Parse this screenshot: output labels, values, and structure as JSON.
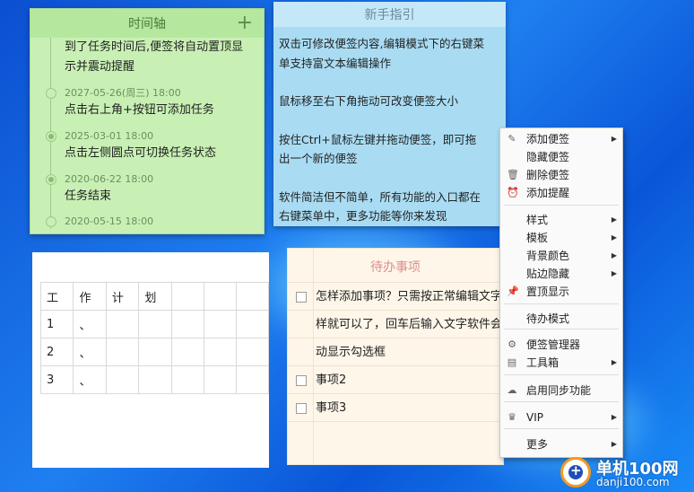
{
  "timeline": {
    "title": "时间轴",
    "add_icon": "plus-icon",
    "top_text": [
      "到了任务时间后,便签将自动置顶显",
      "示并震动提醒"
    ],
    "items": [
      {
        "date": "2027-05-26(周三) 18:00",
        "text": "点击右上角+按钮可添加任务",
        "done": false
      },
      {
        "date": "2025-03-01 18:00",
        "text": "点击左侧圆点可切换任务状态",
        "done": true
      },
      {
        "date": "2020-06-22 18:00",
        "text": "任务结束",
        "done": true
      }
    ],
    "partial_date": "2020-05-15 18:00"
  },
  "guide": {
    "title": "新手指引",
    "paragraphs": [
      [
        "双击可修改便签内容,编辑模式下的右键菜",
        "单支持富文本编辑操作"
      ],
      [
        "鼠标移至右下角拖动可改变便签大小"
      ],
      [
        "按住Ctrl+鼠标左键并拖动便签，即可拖",
        "出一个新的便签"
      ],
      [
        "软件简洁但不简单，所有功能的入口都在",
        "右键菜单中，更多功能等你来发现"
      ]
    ]
  },
  "table_note": {
    "rows": [
      [
        "工",
        "作",
        "计",
        "划",
        "",
        "",
        ""
      ],
      [
        "1",
        "、",
        "",
        "",
        "",
        "",
        ""
      ],
      [
        "2",
        "、",
        "",
        "",
        "",
        "",
        ""
      ],
      [
        "3",
        "、",
        "",
        "",
        "",
        "",
        ""
      ]
    ]
  },
  "todo": {
    "title": "待办事项",
    "rows": [
      {
        "text": "怎样添加事项？只需按正常编辑文字",
        "checkbox": true
      },
      {
        "text": "样就可以了，回车后输入文字软件会",
        "checkbox": false
      },
      {
        "text": "动显示勾选框",
        "checkbox": false
      },
      {
        "text": "事项2",
        "checkbox": true
      },
      {
        "text": "事项3",
        "checkbox": true
      }
    ]
  },
  "menu": {
    "items": [
      {
        "label": "添加便签",
        "icon": "add-note-icon",
        "submenu": true
      },
      {
        "label": "隐藏便签",
        "icon": "",
        "submenu": false
      },
      {
        "label": "删除便签",
        "icon": "trash-icon",
        "submenu": false
      },
      {
        "label": "添加提醒",
        "icon": "alarm-clock-icon",
        "submenu": false
      },
      {
        "label": "样式",
        "icon": "",
        "submenu": true
      },
      {
        "label": "模板",
        "icon": "",
        "submenu": true
      },
      {
        "label": "背景颜色",
        "icon": "",
        "submenu": true
      },
      {
        "label": "贴边隐藏",
        "icon": "",
        "submenu": true
      },
      {
        "label": "置顶显示",
        "icon": "pin-icon",
        "submenu": false
      },
      {
        "label": "待办模式",
        "icon": "",
        "submenu": false
      },
      {
        "label": "便签管理器",
        "icon": "gear-icon",
        "submenu": false
      },
      {
        "label": "工具箱",
        "icon": "toolbox-icon",
        "submenu": true
      },
      {
        "label": "启用同步功能",
        "icon": "cloud-icon",
        "submenu": false
      },
      {
        "label": "VIP",
        "icon": "crown-icon",
        "submenu": true
      },
      {
        "label": "更多",
        "icon": "",
        "submenu": true
      }
    ]
  },
  "watermark": {
    "line1": "单机100网",
    "line2": "danji100.com"
  }
}
